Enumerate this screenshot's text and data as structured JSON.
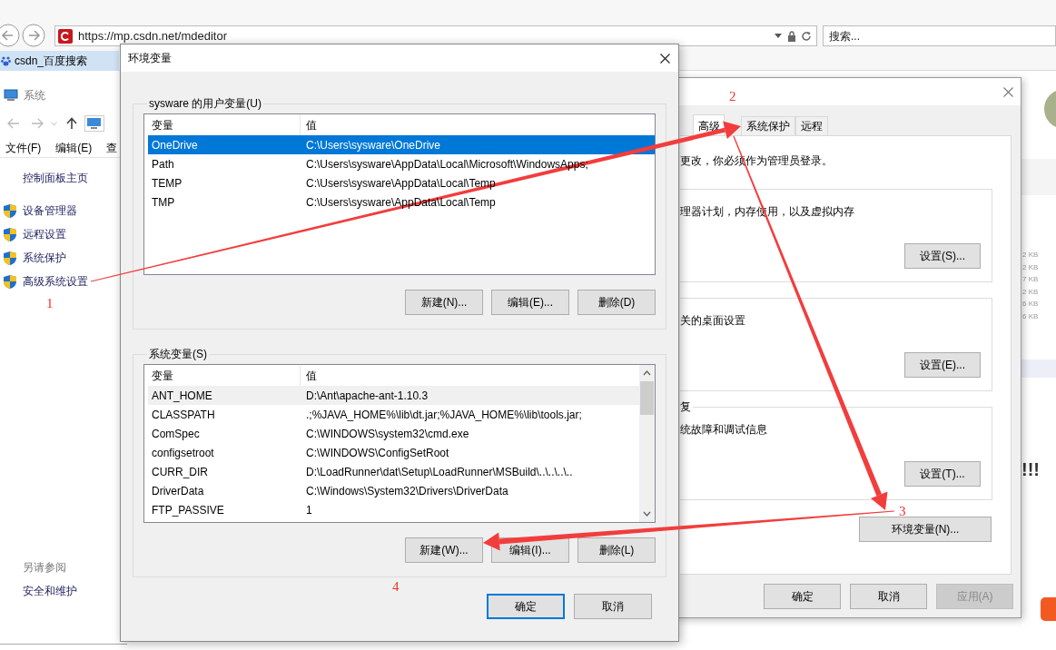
{
  "browser": {
    "url": "https://mp.csdn.net/mdeditor",
    "search_placeholder": "搜索...",
    "tab_title": "csdn_百度搜索"
  },
  "system_window": {
    "title": "系统",
    "menu": [
      "文件(F)",
      "编辑(E)",
      "查"
    ],
    "home_link": "控制面板主页",
    "tasks": [
      "设备管理器",
      "远程设置",
      "系统保护",
      "高级系统设置"
    ],
    "see_also_heading": "另请参阅",
    "see_also": [
      "安全和维护"
    ]
  },
  "env_dialog": {
    "title": "环境变量",
    "user_group": {
      "label": "sysware 的用户变量(U)",
      "focused": true,
      "columns": [
        "变量",
        "值"
      ],
      "rows": [
        {
          "name": "OneDrive",
          "value": "C:\\Users\\sysware\\OneDrive",
          "selected": true
        },
        {
          "name": "Path",
          "value": "C:\\Users\\sysware\\AppData\\Local\\Microsoft\\WindowsApps;",
          "selected": false
        },
        {
          "name": "TEMP",
          "value": "C:\\Users\\sysware\\AppData\\Local\\Temp",
          "selected": false
        },
        {
          "name": "TMP",
          "value": "C:\\Users\\sysware\\AppData\\Local\\Temp",
          "selected": false
        }
      ],
      "buttons": [
        "新建(N)...",
        "编辑(E)...",
        "删除(D)"
      ]
    },
    "system_group": {
      "label": "系统变量(S)",
      "focused": false,
      "columns": [
        "变量",
        "值"
      ],
      "rows": [
        {
          "name": "ANT_HOME",
          "value": "D:\\Ant\\apache-ant-1.10.3",
          "selected": true
        },
        {
          "name": "CLASSPATH",
          "value": ".;%JAVA_HOME%\\lib\\dt.jar;%JAVA_HOME%\\lib\\tools.jar;",
          "selected": false
        },
        {
          "name": "ComSpec",
          "value": "C:\\WINDOWS\\system32\\cmd.exe",
          "selected": false
        },
        {
          "name": "configsetroot",
          "value": "C:\\WINDOWS\\ConfigSetRoot",
          "selected": false
        },
        {
          "name": "CURR_DIR",
          "value": "D:\\LoadRunner\\dat\\Setup\\LoadRunner\\MSBuild\\..\\..\\..\\..",
          "selected": false
        },
        {
          "name": "DriverData",
          "value": "C:\\Windows\\System32\\Drivers\\DriverData",
          "selected": false
        },
        {
          "name": "FTP_PASSIVE",
          "value": "1",
          "selected": false
        }
      ],
      "buttons": [
        "新建(W)...",
        "编辑(I)...",
        "删除(L)"
      ]
    },
    "buttons": [
      {
        "label": "确定",
        "default": true
      },
      {
        "label": "取消",
        "default": false
      }
    ]
  },
  "properties_dialog": {
    "tabs": [
      {
        "label": "高级",
        "selected": true
      },
      {
        "label": "系统保护",
        "selected": false
      },
      {
        "label": "远程",
        "selected": false
      }
    ],
    "notice": "更改，你必须作为管理员登录。",
    "groups": [
      {
        "description": "理器计划，内存使用，以及虚拟内存",
        "button": "设置(S)..."
      },
      {
        "description": "关的桌面设置",
        "button": "设置(E)..."
      },
      {
        "label": "复",
        "description": "统故障和调试信息",
        "button": "设置(T)..."
      }
    ],
    "env_button": "环境变量(N)...",
    "buttons": [
      {
        "label": "确定",
        "disabled": false
      },
      {
        "label": "取消",
        "disabled": false
      },
      {
        "label": "应用(A)",
        "disabled": true
      }
    ]
  },
  "background_page": {
    "sizes": [
      "2 KB",
      "2 KB",
      "7 KB",
      "2 KB",
      "6 KB",
      "6 KB"
    ],
    "headline": "!!!"
  },
  "annotations": [
    {
      "label": "1"
    },
    {
      "label": "2"
    },
    {
      "label": "3"
    },
    {
      "label": "4"
    }
  ]
}
